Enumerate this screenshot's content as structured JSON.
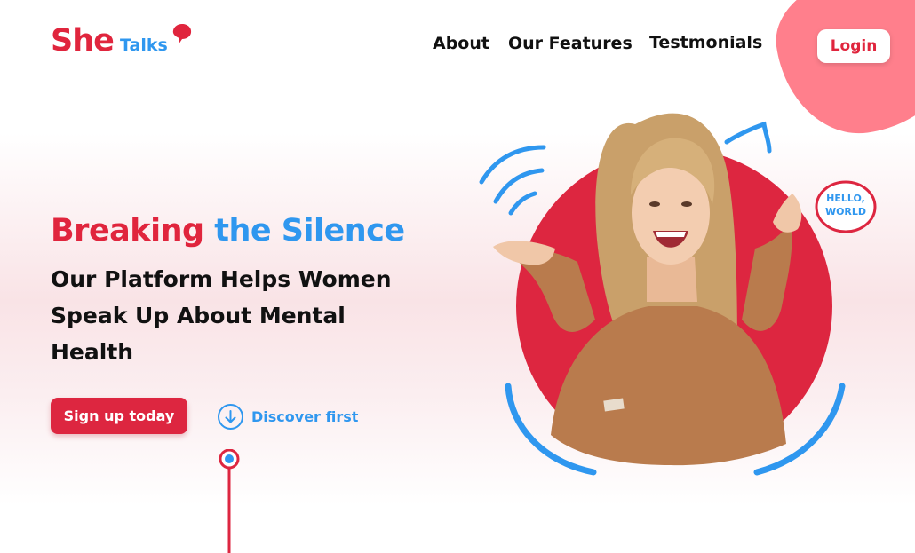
{
  "brand": {
    "name_primary": "She",
    "name_secondary": "Talks",
    "colors": {
      "red": "#e0253d",
      "blue": "#2f97ef",
      "pink": "#ff7f8c"
    }
  },
  "nav": {
    "items": [
      {
        "label": "About"
      },
      {
        "label": "Our Features"
      },
      {
        "label": "Testmonials"
      }
    ],
    "login_label": "Login"
  },
  "hero": {
    "headline_part1": "Breaking",
    "headline_part2": "the Silence",
    "subheadline": "Our Platform Helps Women Speak Up About Mental Health",
    "cta_primary": "Sign up today",
    "cta_secondary": "Discover first",
    "cta_secondary_icon": "arrow-down-circle-icon",
    "badge_text_line1": "HELLO,",
    "badge_text_line2": "WORLD",
    "image_description_icon": "smiling-woman-photo"
  }
}
